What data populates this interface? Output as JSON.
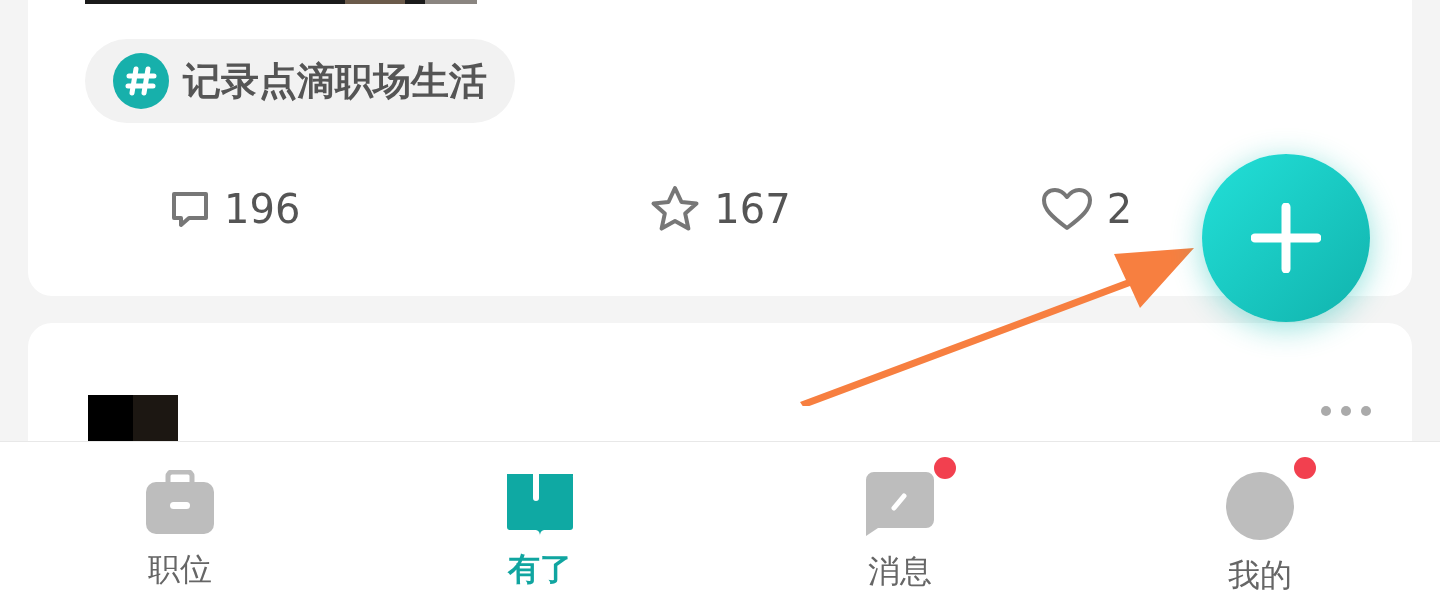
{
  "post_card": {
    "topic_tag": {
      "label": "记录点滴职场生活"
    },
    "stats": [
      {
        "kind": "comment",
        "count": "196"
      },
      {
        "kind": "star",
        "count": "167"
      },
      {
        "kind": "heart",
        "count": "2"
      }
    ]
  },
  "tabs": [
    {
      "kind": "briefcase",
      "label": "职位",
      "selected": false,
      "badge": false
    },
    {
      "kind": "book",
      "label": "有了",
      "selected": true,
      "badge": false
    },
    {
      "kind": "message",
      "label": "消息",
      "selected": false,
      "badge": true
    },
    {
      "kind": "avatar",
      "label": "我的",
      "selected": false,
      "badge": true
    }
  ]
}
